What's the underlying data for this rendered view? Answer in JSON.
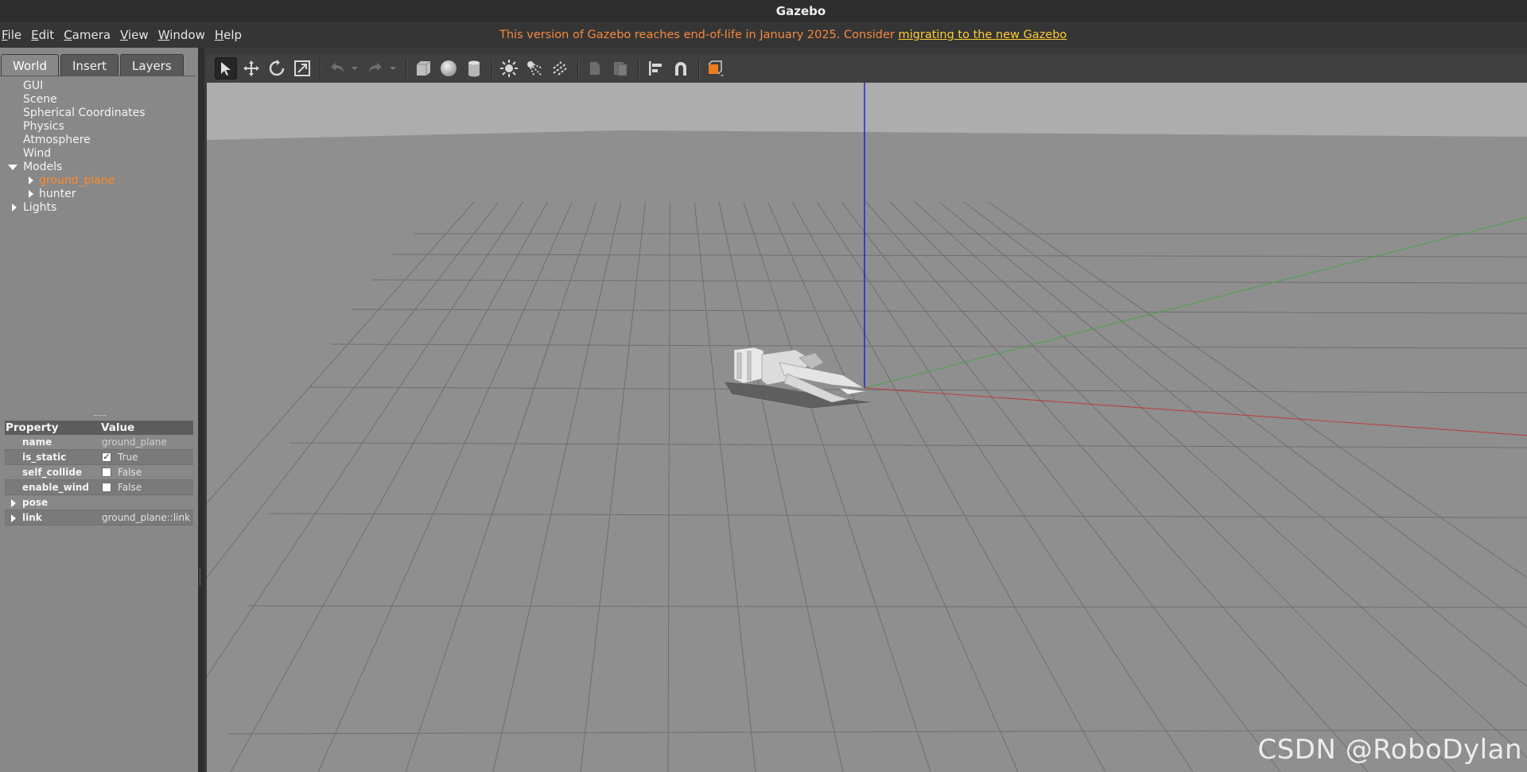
{
  "window": {
    "title": "Gazebo"
  },
  "menubar": {
    "items": [
      {
        "label": "File",
        "underline": "F",
        "rest": "ile"
      },
      {
        "label": "Edit",
        "underline": "E",
        "rest": "dit"
      },
      {
        "label": "Camera",
        "underline": "C",
        "rest": "amera"
      },
      {
        "label": "View",
        "underline": "V",
        "rest": "iew"
      },
      {
        "label": "Window",
        "underline": "W",
        "rest": "indow"
      },
      {
        "label": "Help",
        "underline": "H",
        "rest": "elp"
      }
    ],
    "notice_text": "This version of Gazebo reaches end-of-life in January 2025. Consider ",
    "notice_link": "migrating to the new Gazebo",
    "notice_color": "#f5893f",
    "link_color": "#ffcc33"
  },
  "tabs": [
    "World",
    "Insert",
    "Layers"
  ],
  "active_tab": "World",
  "tree": {
    "items": [
      "GUI",
      "Scene",
      "Spherical Coordinates",
      "Physics",
      "Atmosphere",
      "Wind"
    ],
    "models_label": "Models",
    "models": [
      "ground_plane",
      "hunter"
    ],
    "selected_model": "ground_plane",
    "lights_label": "Lights"
  },
  "properties": {
    "header_property": "Property",
    "header_value": "Value",
    "rows": [
      {
        "name": "name",
        "value": "ground_plane"
      },
      {
        "name": "is_static",
        "value": "True",
        "checked": true
      },
      {
        "name": "self_collide",
        "value": "False",
        "checked": false
      },
      {
        "name": "enable_wind",
        "value": "False",
        "checked": false
      }
    ],
    "pose_label": "pose",
    "link_label": "link",
    "link_value": "ground_plane::link"
  },
  "toolbar": {
    "icons": [
      "select-arrow-icon",
      "translate-icon",
      "rotate-icon",
      "scale-icon",
      "undo-icon",
      "redo-icon",
      "box-icon",
      "sphere-icon",
      "cylinder-icon",
      "point-light-icon",
      "spot-light-icon",
      "directional-light-icon",
      "copy-icon",
      "paste-icon",
      "align-icon",
      "snap-icon",
      "view-angle-icon"
    ]
  },
  "viewport": {
    "selection_color": "#ff8a2a",
    "x_axis_color": "#c0302a",
    "y_axis_color": "#3fa63f",
    "z_axis_color": "#1010e0"
  },
  "watermark": "CSDN @RoboDylan"
}
